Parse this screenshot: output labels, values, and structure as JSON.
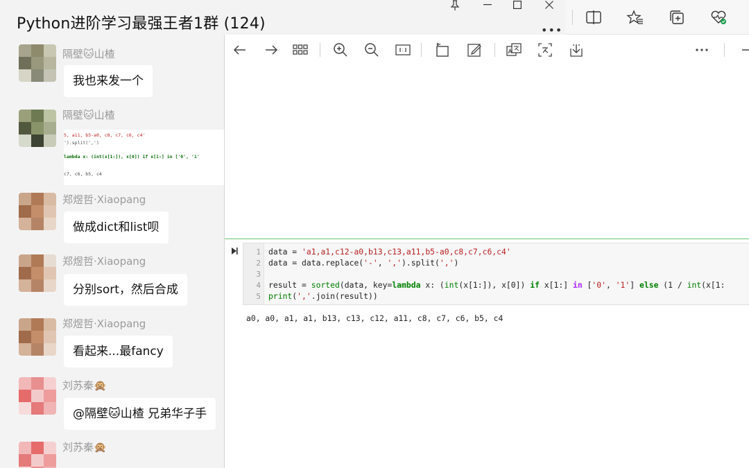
{
  "chat": {
    "title": "Python进阶学习最强王者1群 (124)",
    "more_label": "•••",
    "messages": [
      {
        "sender": "隔壁🐱山楂",
        "text": "我也来发一个"
      },
      {
        "sender": "隔壁🐱山楂",
        "code_lines": [
          "5, a11, b5-a0, c8, c7, c6, c4'",
          "').split(',')",
          "lambda x: (int(x[1:]), x[0]) if x[1:] in ['0', '1'",
          "c7, c6, b5, c4"
        ]
      },
      {
        "sender": "郑煜哲·Xiaopang",
        "text": "做成dict和list呗"
      },
      {
        "sender": "郑煜哲·Xiaopang",
        "text": "分别sort，然后合成"
      },
      {
        "sender": "郑煜哲·Xiaopang",
        "text": "看起来...最fancy"
      },
      {
        "sender": "刘苏秦🙊",
        "text": "@隔壁🐱山楂 兄弟华子手"
      },
      {
        "sender": "刘苏秦🙊",
        "text": ""
      }
    ]
  },
  "notebook": {
    "line_numbers": [
      "1",
      "2",
      "3",
      "4",
      "5"
    ],
    "code": {
      "l1_a": "data = ",
      "l1_str": "'a1,a1,c12-a0,b13,c13,a11,b5-a0,c8,c7,c6,c4'",
      "l2_a": "data = data.replace(",
      "l2_s1": "'-'",
      "l2_b": ", ",
      "l2_s2": "','",
      "l2_c": ").split(",
      "l2_s3": "','",
      "l2_d": ")",
      "l4_a": "result = ",
      "l4_fn": "sorted",
      "l4_b": "(data, key=",
      "l4_kw1": "lambda",
      "l4_c": " x: (",
      "l4_fn2": "int",
      "l4_d": "(x[1:]), x[0]) ",
      "l4_kw2": "if",
      "l4_e": " x[1:] ",
      "l4_op": "in",
      "l4_f": " [",
      "l4_s1": "'0'",
      "l4_g": ", ",
      "l4_s2": "'1'",
      "l4_h": "] ",
      "l4_kw3": "else",
      "l4_i": " (1 / ",
      "l4_fn3": "int",
      "l4_j": "(x[1:",
      "l5_fn": "print",
      "l5_a": "(",
      "l5_s": "','",
      "l5_b": ".join(result))"
    },
    "output": "a0, a0, a1, a1, b13, c13, c12, a11, c8, c7, c6, b5, c4"
  },
  "colors": {
    "keyword": "#008000",
    "string": "#ba2121",
    "operator": "#aa22ff",
    "cell_rule": "#6cc36c"
  }
}
